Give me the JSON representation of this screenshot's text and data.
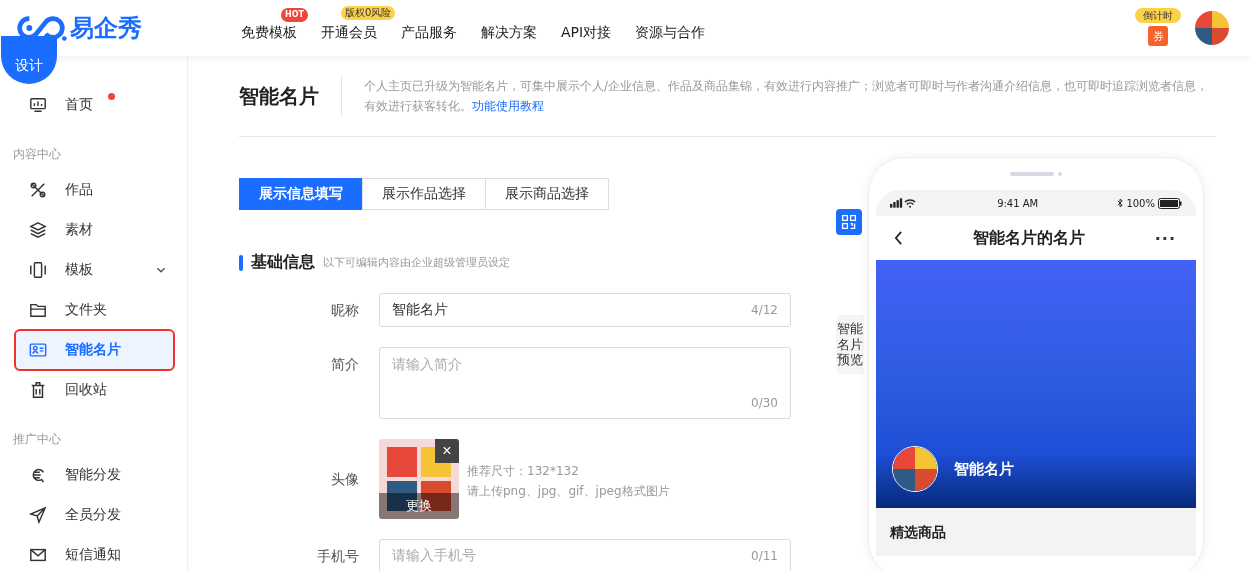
{
  "header": {
    "brand": "易企秀",
    "nav": [
      {
        "label": "免费模板",
        "badge": "HOT",
        "kind": "hot"
      },
      {
        "label": "开通会员",
        "badge": "版权0风险",
        "kind": "promo"
      },
      {
        "label": "产品服务"
      },
      {
        "label": "解决方案"
      },
      {
        "label": "API对接"
      },
      {
        "label": "资源与合作"
      }
    ],
    "countdown": "倒计时",
    "coupon": "券"
  },
  "design_button": "设计",
  "sidebar": {
    "items": [
      {
        "kind": "item",
        "label": "首页",
        "dot": true,
        "selected": false
      },
      {
        "kind": "section",
        "label": "内容中心"
      },
      {
        "kind": "item",
        "label": "作品",
        "selected": false
      },
      {
        "kind": "item",
        "label": "素材",
        "selected": false
      },
      {
        "kind": "item",
        "label": "模板",
        "expandable": true,
        "selected": false
      },
      {
        "kind": "item",
        "label": "文件夹",
        "selected": false
      },
      {
        "kind": "item",
        "label": "智能名片",
        "selected": true
      },
      {
        "kind": "item",
        "label": "回收站",
        "selected": false
      },
      {
        "kind": "section",
        "label": "推广中心"
      },
      {
        "kind": "item",
        "label": "智能分发",
        "selected": false
      },
      {
        "kind": "item",
        "label": "全员分发",
        "selected": false
      },
      {
        "kind": "item",
        "label": "短信通知",
        "selected": false
      }
    ]
  },
  "page": {
    "title": "智能名片",
    "description": "个人主页已升级为智能名片，可集中展示个人/企业信息、作品及商品集锦，有效进行内容推广；浏览者可即时与作者沟通介绍信息，也可即时追踪浏览者信息，有效进行获客转化。",
    "link": "功能使用教程"
  },
  "tabs": [
    {
      "label": "展示信息填写",
      "selected": true
    },
    {
      "label": "展示作品选择",
      "selected": false
    },
    {
      "label": "展示商品选择",
      "selected": false
    }
  ],
  "section": {
    "title": "基础信息",
    "note": "以下可编辑内容由企业超级管理员设定"
  },
  "form": [
    {
      "kind": "input",
      "label": "昵称",
      "value": "智能名片",
      "counter": "4/12"
    },
    {
      "kind": "textarea",
      "label": "简介",
      "placeholder": "请输入简介",
      "counter": "0/30"
    },
    {
      "kind": "avatar",
      "label": "头像",
      "overlay": "更换",
      "remove": "×",
      "hints": [
        "推荐尺寸：132*132",
        "请上传png、jpg、gif、jpeg格式图片"
      ]
    },
    {
      "kind": "input",
      "label": "手机号",
      "placeholder": "请输入手机号",
      "counter": "0/11"
    }
  ],
  "preview": {
    "tab_label": "智能名片预览",
    "status": {
      "time": "9:41 AM",
      "battery": "100%"
    },
    "nav_title": "智能名片的名片",
    "more": "···",
    "card_name": "智能名片",
    "section": "精选商品"
  }
}
